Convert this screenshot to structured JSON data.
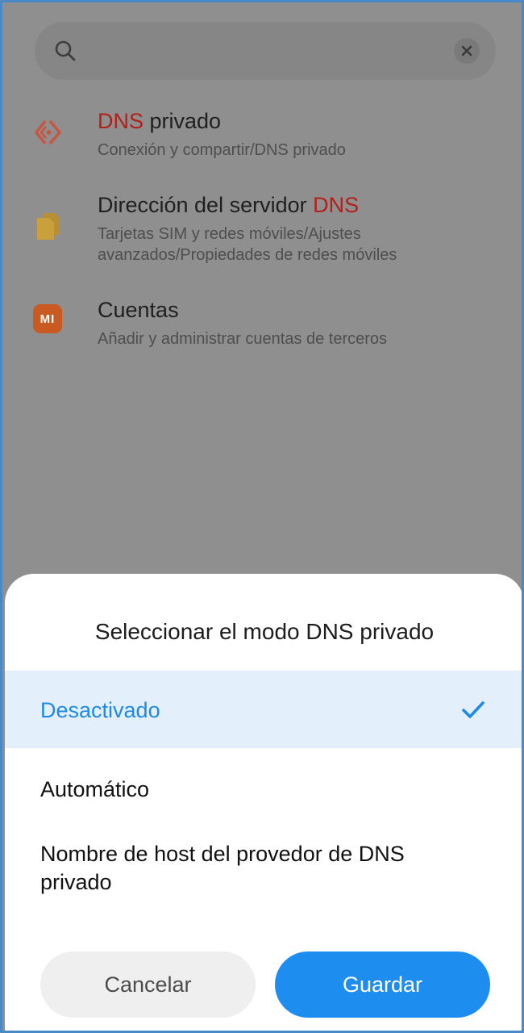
{
  "search": {
    "value": "",
    "placeholder": "",
    "icon": "search-icon",
    "clear_icon": "clear-icon"
  },
  "results": [
    {
      "title_highlight": "DNS",
      "title_rest": " privado",
      "subtitle": "Conexión y compartir/DNS privado",
      "icon": "vpn-icon",
      "icon_color": "#c9543f"
    },
    {
      "title_prefix": "Dirección del servidor ",
      "title_highlight": "DNS",
      "subtitle": "Tarjetas SIM y redes móviles/Ajustes avanzados/Propiedades de redes móviles",
      "icon": "sim-card-icon",
      "icon_color": "#c9a03b"
    },
    {
      "title": "Cuentas",
      "subtitle": "Añadir y administrar cuentas de terceros",
      "icon": "mi-logo-icon",
      "icon_color": "#c85a22",
      "icon_text": "MI"
    }
  ],
  "dialog": {
    "title": "Seleccionar el modo DNS privado",
    "options": [
      {
        "label": "Desactivado",
        "selected": true
      },
      {
        "label": "Automático",
        "selected": false
      },
      {
        "label": "Nombre de host del provedor de DNS privado",
        "selected": false
      }
    ],
    "cancel_label": "Cancelar",
    "save_label": "Guardar",
    "accent_color": "#1e8df0"
  },
  "colors": {
    "highlight": "#b3201a",
    "overlay_bg": "#8f8f8f",
    "selected_bg": "#e3effb"
  }
}
